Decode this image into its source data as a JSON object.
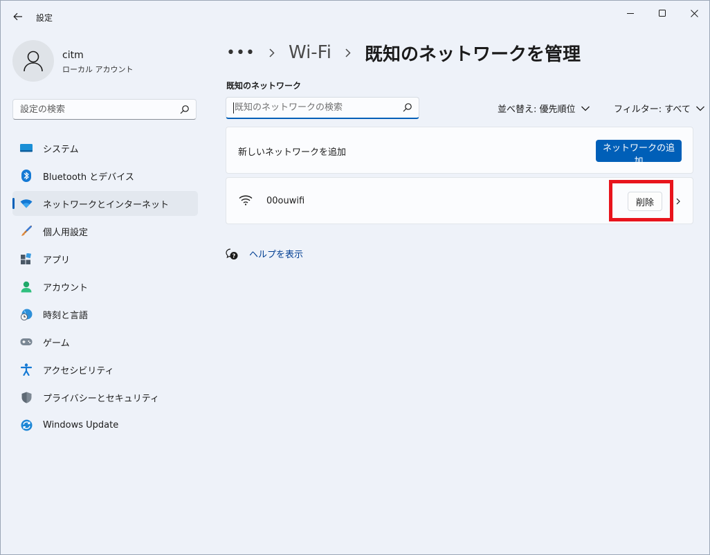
{
  "window": {
    "title": "設定"
  },
  "profile": {
    "name": "citm",
    "type": "ローカル アカウント"
  },
  "search": {
    "placeholder": "設定の検索"
  },
  "nav": [
    {
      "label": "システム",
      "icon": "monitor-icon"
    },
    {
      "label": "Bluetooth とデバイス",
      "icon": "bluetooth-icon"
    },
    {
      "label": "ネットワークとインターネット",
      "icon": "wifi-icon",
      "active": true
    },
    {
      "label": "個人用設定",
      "icon": "brush-icon"
    },
    {
      "label": "アプリ",
      "icon": "apps-icon"
    },
    {
      "label": "アカウント",
      "icon": "person-icon"
    },
    {
      "label": "時刻と言語",
      "icon": "clock-globe-icon"
    },
    {
      "label": "ゲーム",
      "icon": "gamepad-icon"
    },
    {
      "label": "アクセシビリティ",
      "icon": "accessibility-icon"
    },
    {
      "label": "プライバシーとセキュリティ",
      "icon": "shield-icon"
    },
    {
      "label": "Windows Update",
      "icon": "sync-icon"
    }
  ],
  "breadcrumb": {
    "dots": "•••",
    "parent": "Wi-Fi",
    "current": "既知のネットワークを管理"
  },
  "known": {
    "section_title": "既知のネットワーク",
    "search_placeholder": "既知のネットワークの検索",
    "sort_label": "並べ替え: 優先順位",
    "filter_label": "フィルター: すべて",
    "add_label": "新しいネットワークを追加",
    "add_button": "ネットワークの追加",
    "networks": [
      {
        "name": "00ouwifi",
        "delete_label": "削除"
      }
    ]
  },
  "help": {
    "label": "ヘルプを表示"
  },
  "colors": {
    "accent": "#005fb8",
    "highlight": "#e8141c",
    "background": "#eef2f9"
  }
}
